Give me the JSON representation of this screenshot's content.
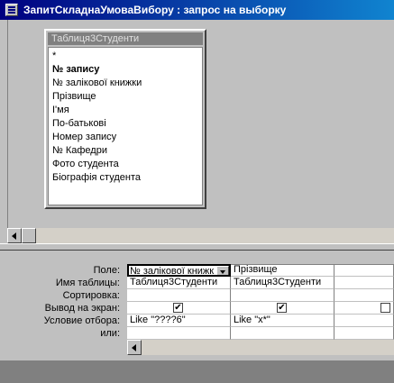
{
  "window": {
    "title": "ЗапитСкладнаУмоваВибору : запрос на выборку"
  },
  "table": {
    "title": "Таблиця3Студенти",
    "fields": [
      {
        "label": "*",
        "bold": false
      },
      {
        "label": "№ запису",
        "bold": true
      },
      {
        "label": "№ залікової книжки",
        "bold": false
      },
      {
        "label": "Прізвище",
        "bold": false
      },
      {
        "label": "І'мя",
        "bold": false
      },
      {
        "label": "По-батькові",
        "bold": false
      },
      {
        "label": "Номер запису",
        "bold": false
      },
      {
        "label": "№ Кафедри",
        "bold": false
      },
      {
        "label": "Фото студента",
        "bold": false
      },
      {
        "label": "Біографія студента",
        "bold": false
      }
    ]
  },
  "grid": {
    "row_labels": [
      "Поле:",
      "Имя таблицы:",
      "Сортировка:",
      "Вывод на экран:",
      "Условие отбора:",
      "или:"
    ],
    "columns": [
      {
        "field": "№ залікової книжк",
        "table": "Таблиця3Студенти",
        "sort": "",
        "show": true,
        "criteria": "Like \"????6\"",
        "or": ""
      },
      {
        "field": "Прізвище",
        "table": "Таблиця3Студенти",
        "sort": "",
        "show": true,
        "criteria": "Like \"х*\"",
        "or": ""
      },
      {
        "field": "",
        "table": "",
        "sort": "",
        "show": false,
        "criteria": "",
        "or": ""
      }
    ]
  },
  "icons": {
    "system_menu": "query-icon",
    "scroll_left": "arrow-left-icon",
    "dropdown": "chevron-down-icon",
    "checkmark": "✔"
  }
}
